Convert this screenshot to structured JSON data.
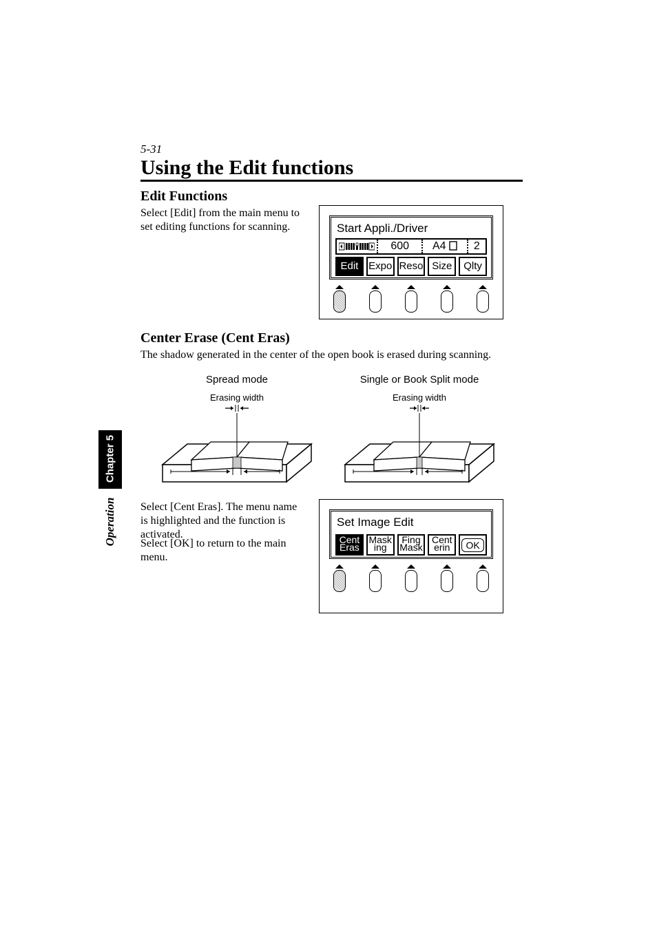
{
  "page_number": "5-31",
  "title": "Using the Edit functions",
  "sidebar": {
    "chapter": "Chapter 5",
    "section": "Operation"
  },
  "section1": {
    "heading": "Edit Functions",
    "text": "Select [Edit] from the main menu to set editing functions for scanning."
  },
  "panel1": {
    "title": "Start Appli./Driver",
    "status": {
      "reso": "600",
      "paper": "A4",
      "count": "2"
    },
    "keys": [
      "Edit",
      "Expo",
      "Reso",
      "Size",
      "Qlty"
    ]
  },
  "section2": {
    "heading": "Center Erase (Cent Eras)",
    "text": "The shadow generated in the center of the open book is erased during scanning."
  },
  "diagrams": {
    "left_mode": "Spread mode",
    "right_mode": "Single or Book Split mode",
    "erase_label": "Erasing width"
  },
  "section3": {
    "text1": "Select [Cent Eras]. The menu name is highlighted and the function is activated.",
    "text2": "Select [OK] to return to the main menu."
  },
  "panel2": {
    "title": "Set Image Edit",
    "keys": [
      [
        "Cent",
        "Eras"
      ],
      [
        "Mask",
        "ing"
      ],
      [
        "Fing",
        "Mask"
      ],
      [
        "Cent",
        "erin"
      ]
    ],
    "ok": "OK"
  }
}
